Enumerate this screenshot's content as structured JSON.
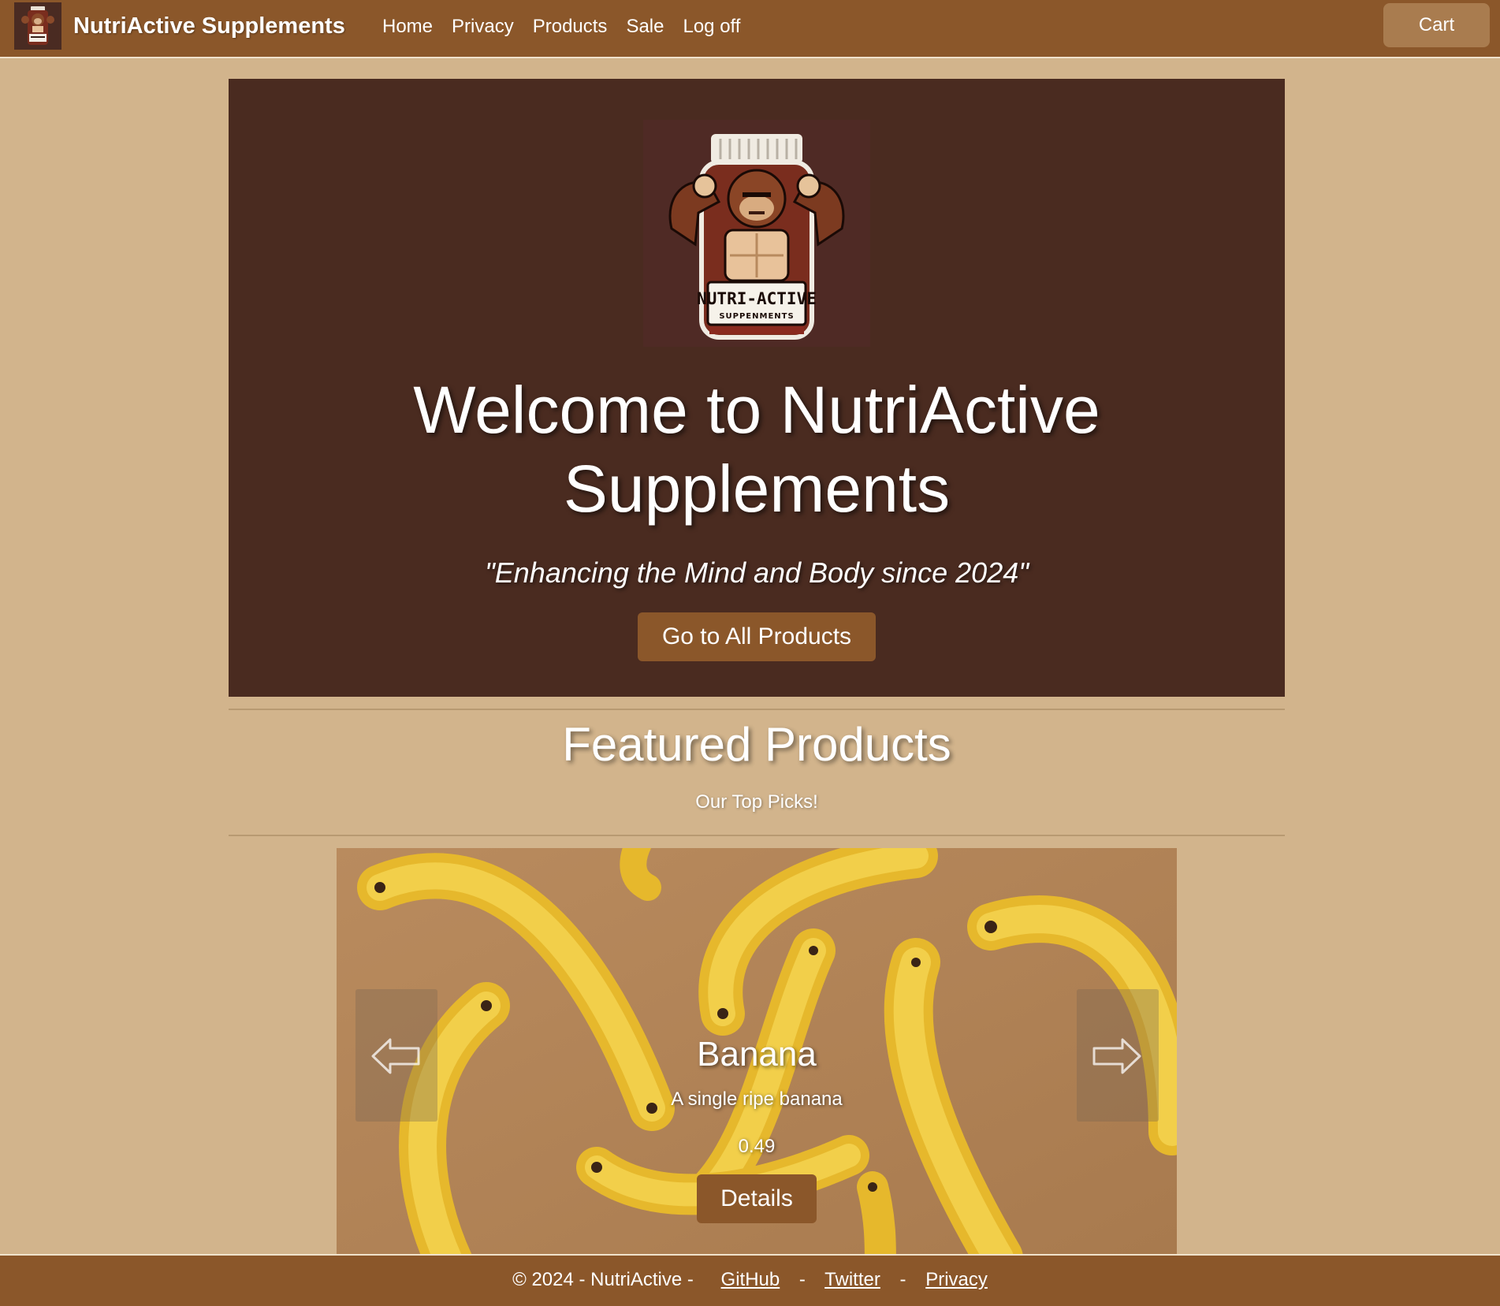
{
  "navbar": {
    "brand_logo_icon": "gorilla-supplement-jar-logo",
    "brand": "NutriActive Supplements",
    "links": [
      "Home",
      "Privacy",
      "Products",
      "Sale",
      "Log off"
    ],
    "cart": "Cart"
  },
  "hero": {
    "logo_icon": "gorilla-supplement-jar-logo",
    "logo_text": "NUTRI-ACTIVE",
    "logo_subtext": "SUPPENMENTS",
    "title_line1": "Welcome to NutriActive",
    "title_line2": "Supplements",
    "tagline": "\"Enhancing the Mind and Body since 2024\"",
    "button": "Go to All Products"
  },
  "featured": {
    "title": "Featured Products",
    "subtitle": "Our Top Picks!"
  },
  "carousel": {
    "image": "bananas-photo",
    "prev_icon": "arrow-left-icon",
    "next_icon": "arrow-right-icon",
    "slide": {
      "title": "Banana",
      "description": "A single ripe banana",
      "price": "0.49",
      "button": "Details"
    }
  },
  "footer": {
    "copyright": "© 2024 - NutriActive -",
    "separator": "-",
    "links": [
      "GitHub",
      "Twitter",
      "Privacy"
    ]
  },
  "colors": {
    "page_bg": "#d2b48c",
    "nav_bg": "#8b572a",
    "hero_bg": "#4a2b20",
    "button_bg": "#8b572a",
    "cart_bg": "#a97c4f"
  }
}
